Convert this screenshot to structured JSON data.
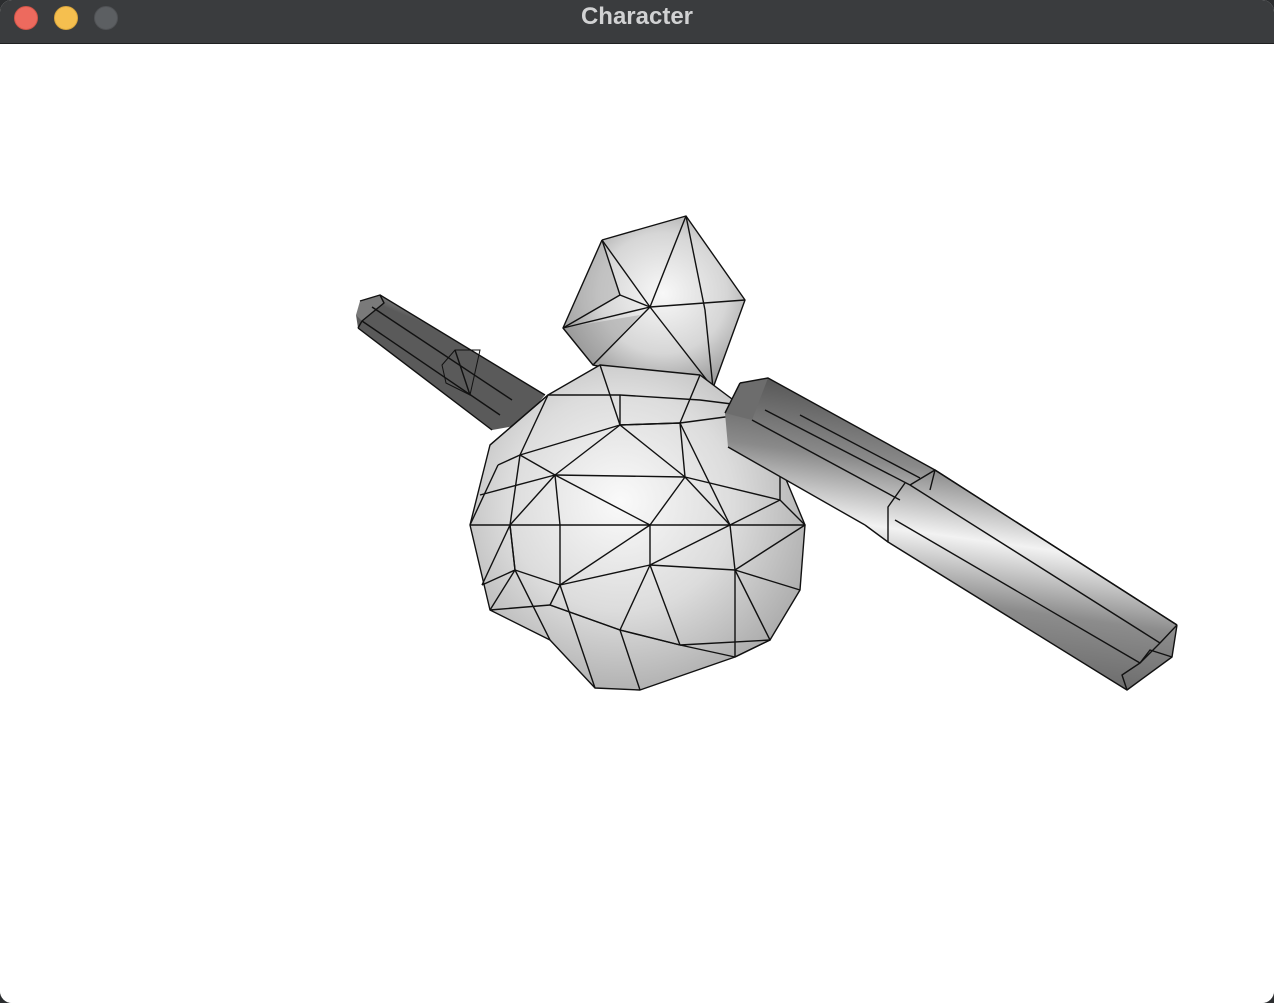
{
  "window": {
    "title": "Character",
    "buttons": {
      "close": "close",
      "minimize": "minimize",
      "zoom": "zoom"
    }
  },
  "scene": {
    "background_color": "#ffffff",
    "objects": [
      {
        "name": "body-sphere",
        "shape": "sphere"
      },
      {
        "name": "head-polyhedron",
        "shape": "polyhedron"
      },
      {
        "name": "left-arm-cylinder",
        "shape": "cylinder"
      },
      {
        "name": "right-arm-cylinder",
        "shape": "cylinder"
      }
    ],
    "render_style": "shaded-wireframe",
    "colors": {
      "surface_light": "#f4f4f4",
      "surface_dark": "#6a6a6a",
      "wire": "#111111"
    }
  }
}
